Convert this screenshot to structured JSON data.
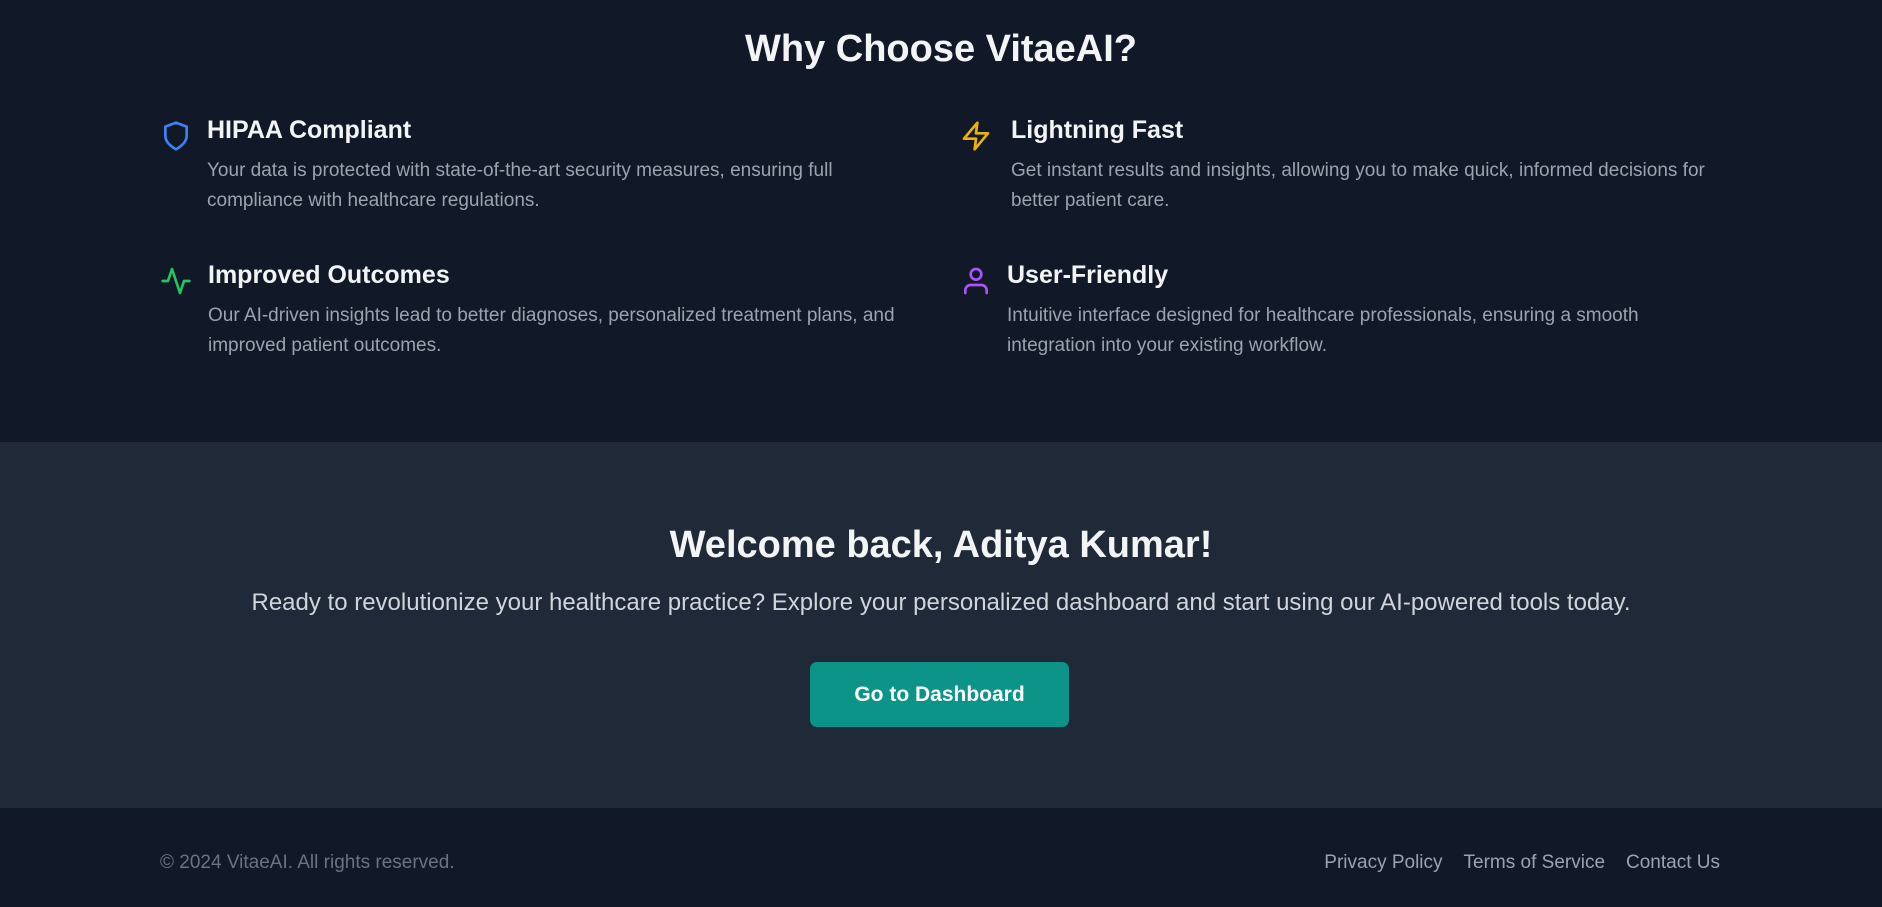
{
  "why_section": {
    "title": "Why Choose VitaeAI?",
    "features": [
      {
        "icon": "shield-icon",
        "icon_color": "#3b82f6",
        "title": "HIPAA Compliant",
        "description": "Your data is protected with state-of-the-art security measures, ensuring full compliance with healthcare regulations."
      },
      {
        "icon": "lightning-icon",
        "icon_color": "#eab308",
        "title": "Lightning Fast",
        "description": "Get instant results and insights, allowing you to make quick, informed decisions for better patient care."
      },
      {
        "icon": "activity-icon",
        "icon_color": "#22c55e",
        "title": "Improved Outcomes",
        "description": "Our AI-driven insights lead to better diagnoses, personalized treatment plans, and improved patient outcomes."
      },
      {
        "icon": "user-icon",
        "icon_color": "#a855f7",
        "title": "User-Friendly",
        "description": "Intuitive interface designed for healthcare professionals, ensuring a smooth integration into your existing workflow."
      }
    ]
  },
  "welcome_section": {
    "title": "Welcome back, Aditya Kumar!",
    "subtitle": "Ready to revolutionize your healthcare practice? Explore your personalized dashboard and start using our AI-powered tools today.",
    "cta_label": "Go to Dashboard",
    "cta_color": "#0d9488"
  },
  "footer": {
    "copyright": "© 2024 VitaeAI. All rights reserved.",
    "links": [
      "Privacy Policy",
      "Terms of Service",
      "Contact Us"
    ]
  },
  "colors": {
    "page_background": "#111827",
    "section_background": "#1f2937",
    "heading_text": "#f3f4f6",
    "body_text": "#9ca3af"
  }
}
